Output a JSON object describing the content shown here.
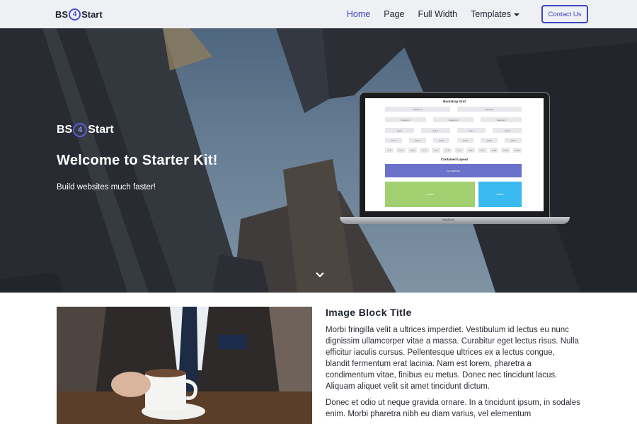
{
  "navbar": {
    "brand_pre": "BS",
    "brand_num": "4",
    "brand_post": "Start",
    "links": [
      {
        "label": "Home",
        "active": true
      },
      {
        "label": "Page"
      },
      {
        "label": "Full Width"
      },
      {
        "label": "Templates"
      }
    ],
    "contact_label": "Contact Us"
  },
  "hero": {
    "logo_pre": "BS",
    "logo_num": "4",
    "logo_post": "Start",
    "title": "Welcome to Starter Kit!",
    "subtitle": "Build websites much faster!",
    "scroll_icon": "chevron-down-icon"
  },
  "laptop": {
    "screen_title": "Bootstrap Grid",
    "row1": [
      "Column 1",
      "Column 2"
    ],
    "row2": [
      "Column 1",
      "Column 2",
      "Column 3"
    ],
    "row3": [
      "Col 1",
      "Col 2",
      "Col 3",
      "Col 4"
    ],
    "row4": [
      "Col 1",
      "Col 2",
      "Col 3",
      "Col 4",
      "Col 5",
      "Col 6"
    ],
    "row5": [
      "C 1",
      "C 2",
      "C 3",
      "C 4",
      "C 5",
      "C 6",
      "C 7",
      "C 8",
      "C 9",
      "C 10",
      "C 11",
      "C 12"
    ],
    "contained_title": "Contained Layout",
    "full_width_bar": "Full Width Bar",
    "content_box": "Content",
    "sidebar_box": "Sidebar",
    "brand_text": "MacBook",
    "colors": {
      "bar": "#6a72c9",
      "content": "#a2d071",
      "sidebar": "#3bbaf0"
    }
  },
  "content": {
    "image_block_title": "Image Block Title",
    "paragraph1": "Morbi fringilla velit a ultrices imperdiet. Vestibulum id lectus eu nunc dignissim ullamcorper vitae a massa. Curabitur eget lectus risus. Nulla efficitur iaculis cursus. Pellentesque ultrices ex a lectus congue, blandit fermentum erat lacinia. Nam est lorem, pharetra a condimentum vitae, finibus eu metus. Donec nec tincidunt lacus. Aliquam aliquet velit sit amet tincidunt dictum.",
    "paragraph2": "Donec et odio ut neque gravida ornare. In a tincidunt ipsum, in sodales enim. Morbi pharetra nibh eu diam varius, vel elementum"
  },
  "theme": {
    "accent": "#3c44c2",
    "navbar_bg": "#eef0f3"
  }
}
